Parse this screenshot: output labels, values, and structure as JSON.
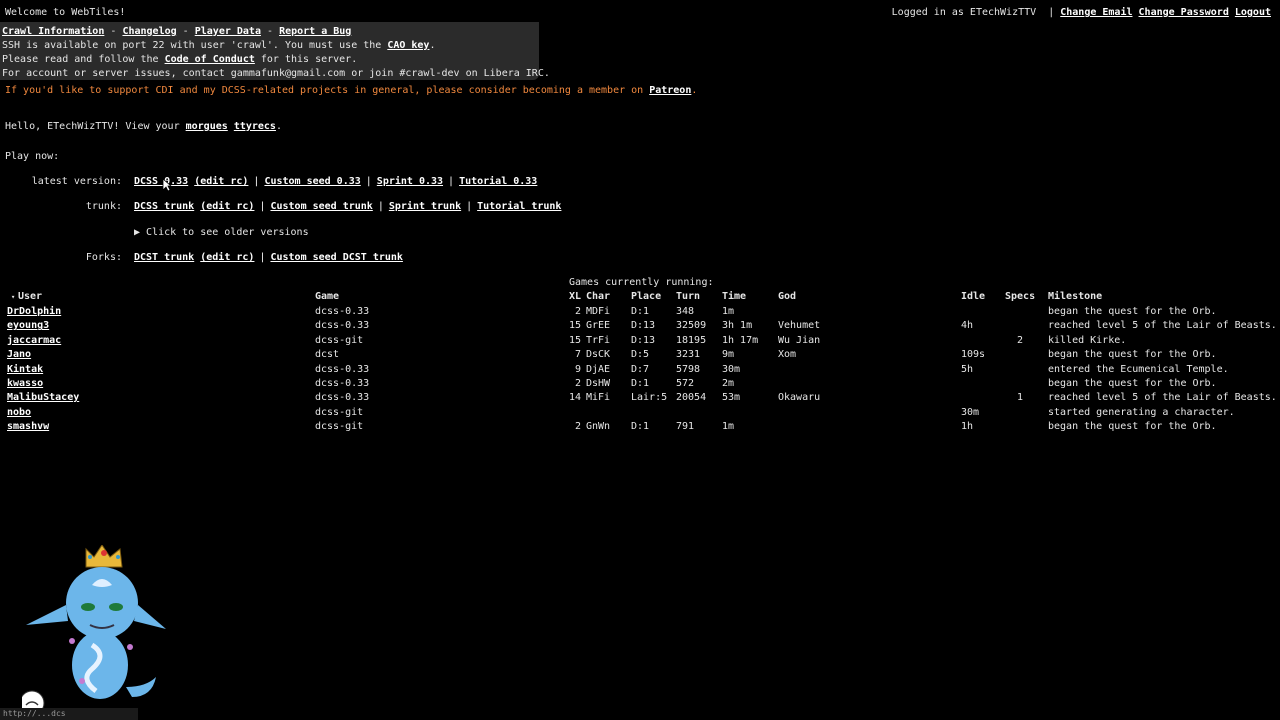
{
  "header": {
    "welcome": "Welcome to WebTiles!",
    "logged_in": "Logged in as ETechWizTTV",
    "links": [
      "Change Email",
      "Change Password",
      "Logout"
    ]
  },
  "info": {
    "links": [
      "Crawl Information",
      "Changelog",
      "Player Data",
      "Report a Bug"
    ],
    "link_sep": "-",
    "ssh_pre": "SSH is available on port 22 with user 'crawl'. You must use the ",
    "ssh_link": "CAO key",
    "ssh_post": ".",
    "coc_pre": "Please read and follow the ",
    "coc_link": "Code of Conduct",
    "coc_post": " for this server.",
    "contact": "For account or server issues, contact gammafunk@gmail.com or join #crawl-dev on Libera IRC."
  },
  "patreon": {
    "text": "If you'd like to support CDI and my DCSS-related projects in general, please consider becoming a member on ",
    "link": "Patreon",
    "post": "."
  },
  "hello": {
    "pre": "Hello, ETechWizTTV! View your ",
    "link1": "morgues",
    "link2": "ttyrecs",
    "post": "."
  },
  "play_now": "Play now:",
  "versions": {
    "latest_label": "latest version:",
    "latest_links": [
      "DCSS 0.33",
      "(edit rc)",
      "Custom seed 0.33",
      "Sprint 0.33",
      "Tutorial 0.33"
    ],
    "trunk_label": "trunk:",
    "trunk_links": [
      "DCSS trunk",
      "(edit rc)",
      "Custom seed trunk",
      "Sprint trunk",
      "Tutorial trunk"
    ],
    "older": "▶ Click to see older versions",
    "forks_label": "Forks:",
    "forks_links": [
      "DCST trunk",
      "(edit rc)",
      "Custom seed DCST trunk"
    ],
    "sep": "|"
  },
  "games": {
    "caption": "Games currently running:",
    "columns": [
      "User",
      "Game",
      "XL",
      "Char",
      "Place",
      "Turn",
      "Time",
      "God",
      "Idle",
      "Specs",
      "Milestone"
    ],
    "sort_marker": "▾",
    "rows": [
      [
        "DrDolphin",
        "dcss-0.33",
        "2",
        "MDFi",
        "D:1",
        "348",
        "1m",
        "",
        "",
        "",
        "began the quest for the Orb."
      ],
      [
        "eyoung3",
        "dcss-0.33",
        "15",
        "GrEE",
        "D:13",
        "32509",
        "3h 1m",
        "Vehumet",
        "4h",
        "",
        "reached level 5 of the Lair of Beasts."
      ],
      [
        "jaccarmac",
        "dcss-git",
        "15",
        "TrFi",
        "D:13",
        "18195",
        "1h 17m",
        "Wu Jian",
        "",
        "2",
        "killed Kirke."
      ],
      [
        "Jano",
        "dcst",
        "7",
        "DsCK",
        "D:5",
        "3231",
        "9m",
        "Xom",
        "109s",
        "",
        "began the quest for the Orb."
      ],
      [
        "Kintak",
        "dcss-0.33",
        "9",
        "DjAE",
        "D:7",
        "5798",
        "30m",
        "",
        "5h",
        "",
        "entered the Ecumenical Temple."
      ],
      [
        "kwasso",
        "dcss-0.33",
        "2",
        "DsHW",
        "D:1",
        "572",
        "2m",
        "",
        "",
        "",
        "began the quest for the Orb."
      ],
      [
        "MalibuStacey",
        "dcss-0.33",
        "14",
        "MiFi",
        "Lair:5",
        "20054",
        "53m",
        "Okawaru",
        "",
        "1",
        "reached level 5 of the Lair of Beasts."
      ],
      [
        "nobo",
        "dcss-git",
        "",
        "",
        "",
        "",
        "",
        "",
        "30m",
        "",
        "started generating a character."
      ],
      [
        "smashvw",
        "dcss-git",
        "2",
        "GnWn",
        "D:1",
        "791",
        "1m",
        "",
        "1h",
        "",
        "began the quest for the Orb."
      ]
    ]
  },
  "status_bar": "http://...dcs"
}
